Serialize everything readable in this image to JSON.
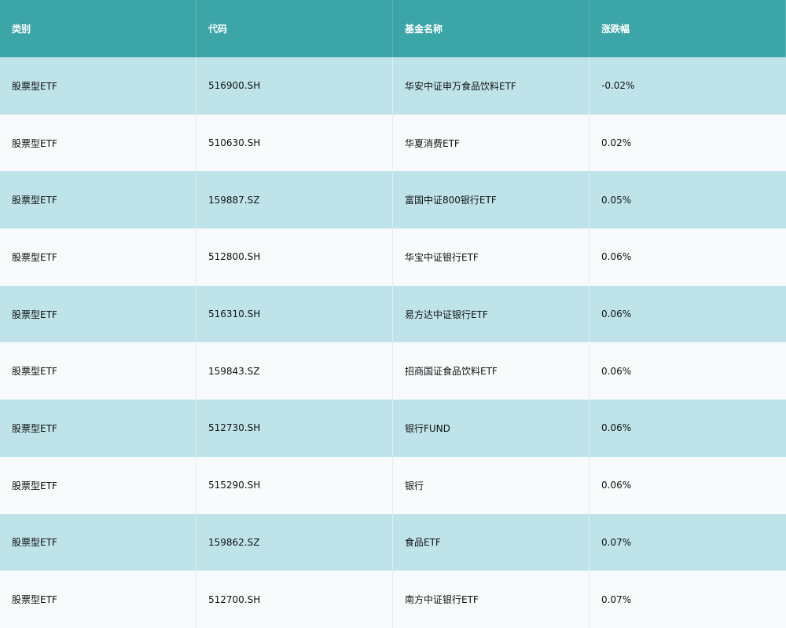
{
  "table": {
    "headers": [
      "类别",
      "代码",
      "基金名称",
      "涨跌幅"
    ],
    "rows": [
      {
        "category": "股票型ETF",
        "code": "516900.SH",
        "name": "华安中证申万食品饮料ETF",
        "change": "-0.02%"
      },
      {
        "category": "股票型ETF",
        "code": "510630.SH",
        "name": "华夏消费ETF",
        "change": "0.02%"
      },
      {
        "category": "股票型ETF",
        "code": "159887.SZ",
        "name": "富国中证800银行ETF",
        "change": "0.05%"
      },
      {
        "category": "股票型ETF",
        "code": "512800.SH",
        "name": "华宝中证银行ETF",
        "change": "0.06%"
      },
      {
        "category": "股票型ETF",
        "code": "516310.SH",
        "name": "易方达中证银行ETF",
        "change": "0.06%"
      },
      {
        "category": "股票型ETF",
        "code": "159843.SZ",
        "name": "招商国证食品饮料ETF",
        "change": "0.06%"
      },
      {
        "category": "股票型ETF",
        "code": "512730.SH",
        "name": "银行FUND",
        "change": "0.06%"
      },
      {
        "category": "股票型ETF",
        "code": "515290.SH",
        "name": "银行",
        "change": "0.06%"
      },
      {
        "category": "股票型ETF",
        "code": "159862.SZ",
        "name": "食品ETF",
        "change": "0.07%"
      },
      {
        "category": "股票型ETF",
        "code": "512700.SH",
        "name": "南方中证银行ETF",
        "change": "0.07%"
      }
    ]
  },
  "colors": {
    "header_bg": "#3ba5a7",
    "row_even_bg": "#bee4ea",
    "row_odd_bg": "#f8fafc",
    "header_text": "#ffffff",
    "body_text": "#111111"
  }
}
